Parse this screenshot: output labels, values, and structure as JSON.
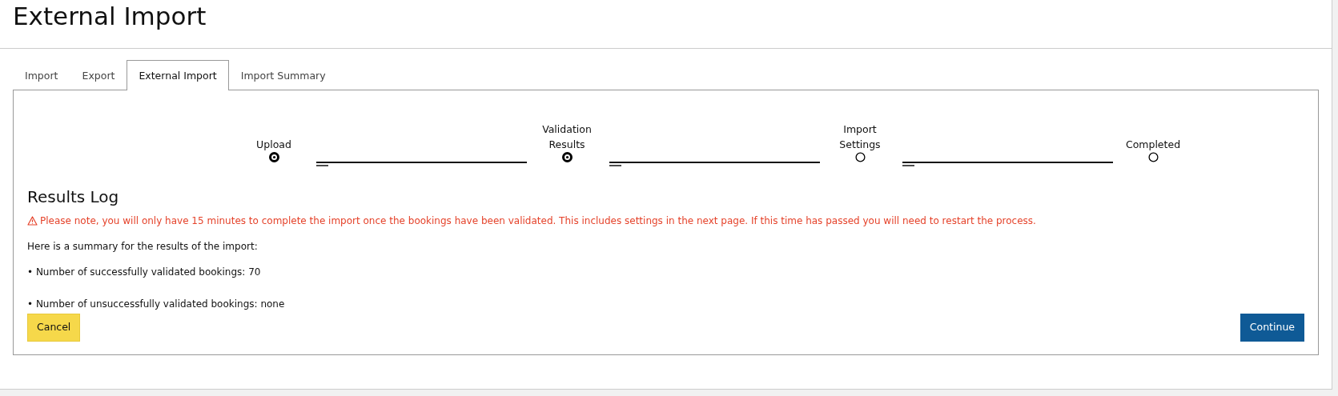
{
  "page_title": "External Import",
  "tabs": [
    {
      "label": "Import",
      "selected": false
    },
    {
      "label": "Export",
      "selected": false
    },
    {
      "label": "External Import",
      "selected": true
    },
    {
      "label": "Import Summary",
      "selected": false
    }
  ],
  "stepper": [
    {
      "label": "Upload",
      "checked": true
    },
    {
      "label": "Validation Results",
      "checked": true
    },
    {
      "label": "Import Settings",
      "checked": false
    },
    {
      "label": "Completed",
      "checked": false
    }
  ],
  "results": {
    "heading": "Results Log",
    "warning": "Please note, you will only have 15 minutes to complete the import once the bookings have been validated. This includes settings in the next page. If this time has passed you will need to restart the process.",
    "intro": "Here is a summary for the results of the import:",
    "items": [
      "• Number of successfully validated bookings: 70",
      "• Number of unsuccessfully validated bookings: none"
    ]
  },
  "buttons": {
    "cancel": "Cancel",
    "continue": "Continue"
  }
}
